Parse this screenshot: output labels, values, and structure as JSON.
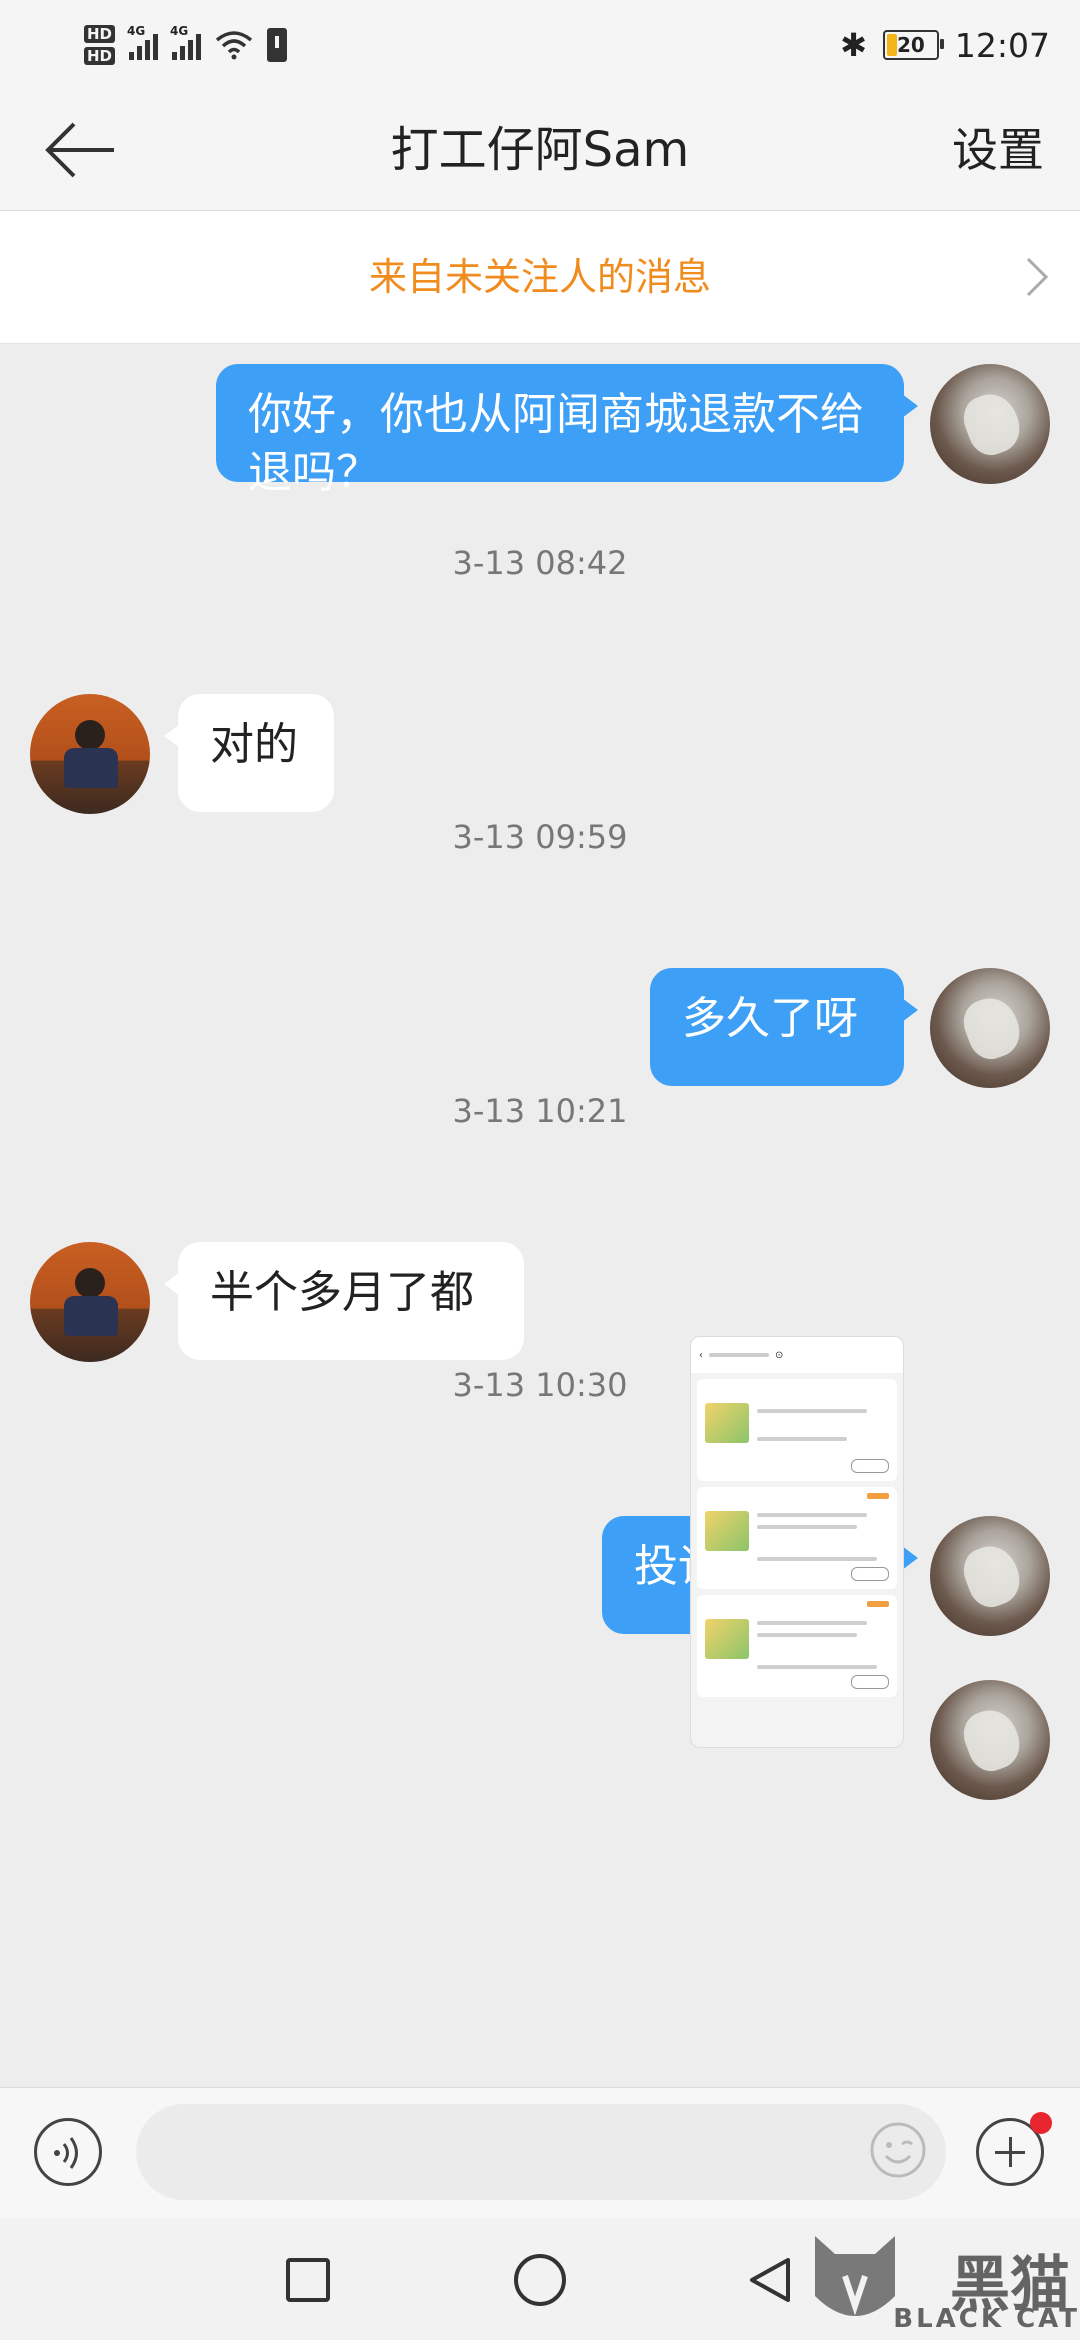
{
  "status_bar": {
    "network_label": "4G",
    "battery_percent": "20",
    "time": "12:07"
  },
  "header": {
    "title": "打工仔阿Sam",
    "settings_label": "设置"
  },
  "notice": {
    "text": "来自未关注人的消息"
  },
  "messages": [
    {
      "from": "me",
      "text": "你好，你也从阿闻商城退款不给退吗？"
    },
    {
      "type": "timestamp",
      "text": "3-13 08:42"
    },
    {
      "from": "them",
      "text": "对的"
    },
    {
      "type": "timestamp",
      "text": "3-13 09:59"
    },
    {
      "from": "me",
      "text": "多久了呀"
    },
    {
      "type": "timestamp",
      "text": "3-13 10:21"
    },
    {
      "from": "them",
      "text": "半个多月了都"
    },
    {
      "type": "timestamp",
      "text": "3-13 10:30"
    },
    {
      "from": "me",
      "text": "投诉了吗？"
    },
    {
      "from": "me",
      "type": "image"
    }
  ],
  "input": {
    "placeholder": "",
    "value": ""
  },
  "watermark": {
    "cn": "黑猫",
    "en": "BLACK CAT"
  },
  "colors": {
    "outgoing_bubble": "#3d9ff5",
    "incoming_bubble": "#ffffff",
    "notice_text": "#f08c1e",
    "badge": "#e8262f"
  }
}
